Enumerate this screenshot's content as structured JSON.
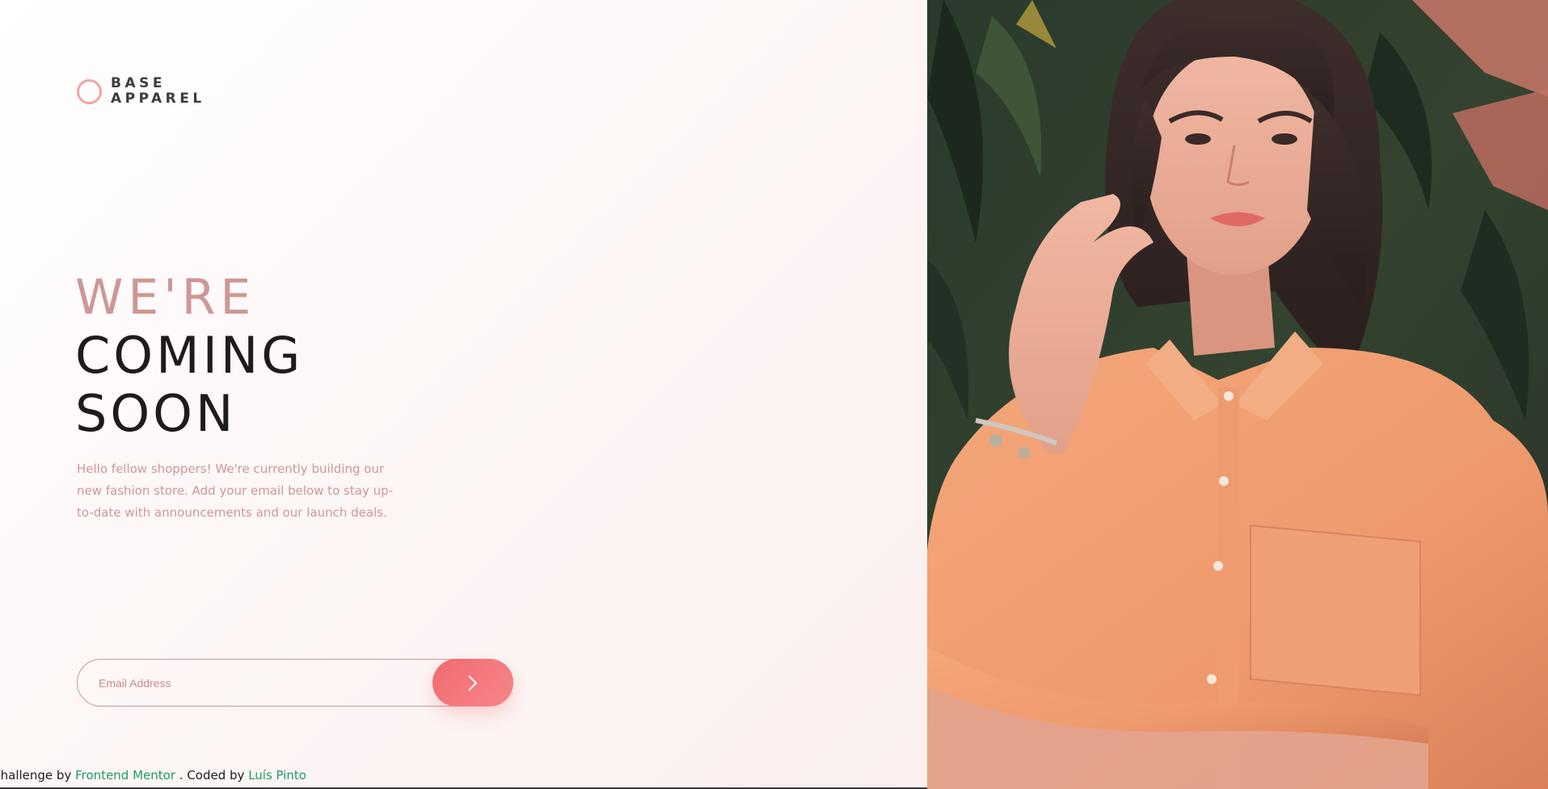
{
  "brand": {
    "line1": "BASE",
    "line2": "APPAREL",
    "icon": "ring-logo-icon",
    "accent_color": "#f0a4a4"
  },
  "headline": {
    "light": "WE'RE",
    "dark_line1": "COMING",
    "dark_line2": "SOON"
  },
  "intro_text": "Hello fellow shoppers! We're currently building our new fashion store. Add your email below to stay up-to-date with announcements and our launch deals.",
  "form": {
    "email_placeholder": "Email Address",
    "submit_icon": "chevron-right-icon",
    "button_color": "#f26a6e"
  },
  "attribution": {
    "prefix": "Challenge by",
    "challenge_link": "Frontend Mentor",
    "middle": ". Coded by",
    "author_link": "Luís Pinto",
    "link_color": "#1f9a6a"
  },
  "hero": {
    "image_alt": "Woman in an orange shirt posing in front of tropical plants"
  }
}
